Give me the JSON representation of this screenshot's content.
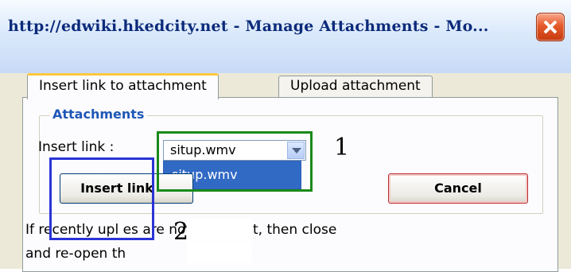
{
  "window": {
    "title": "http://edwiki.hkedcity.net - Manage Attachments - Mo...",
    "close_icon": "close-icon"
  },
  "tabs": [
    {
      "label": "Insert link to attachment",
      "active": true
    },
    {
      "label": "Upload attachment",
      "active": false
    }
  ],
  "attachments": {
    "legend": "Attachments",
    "insert_label": "Insert link :",
    "select_value": "situp.wmv",
    "dropdown_options": [
      "situp.wmv"
    ],
    "insert_button": "Insert link",
    "cancel_button": "Cancel"
  },
  "info": {
    "line1": "If recently upl      es are not in the list, then close",
    "line2": "and re-open th"
  },
  "annotations": {
    "one": "1",
    "two": "2"
  }
}
